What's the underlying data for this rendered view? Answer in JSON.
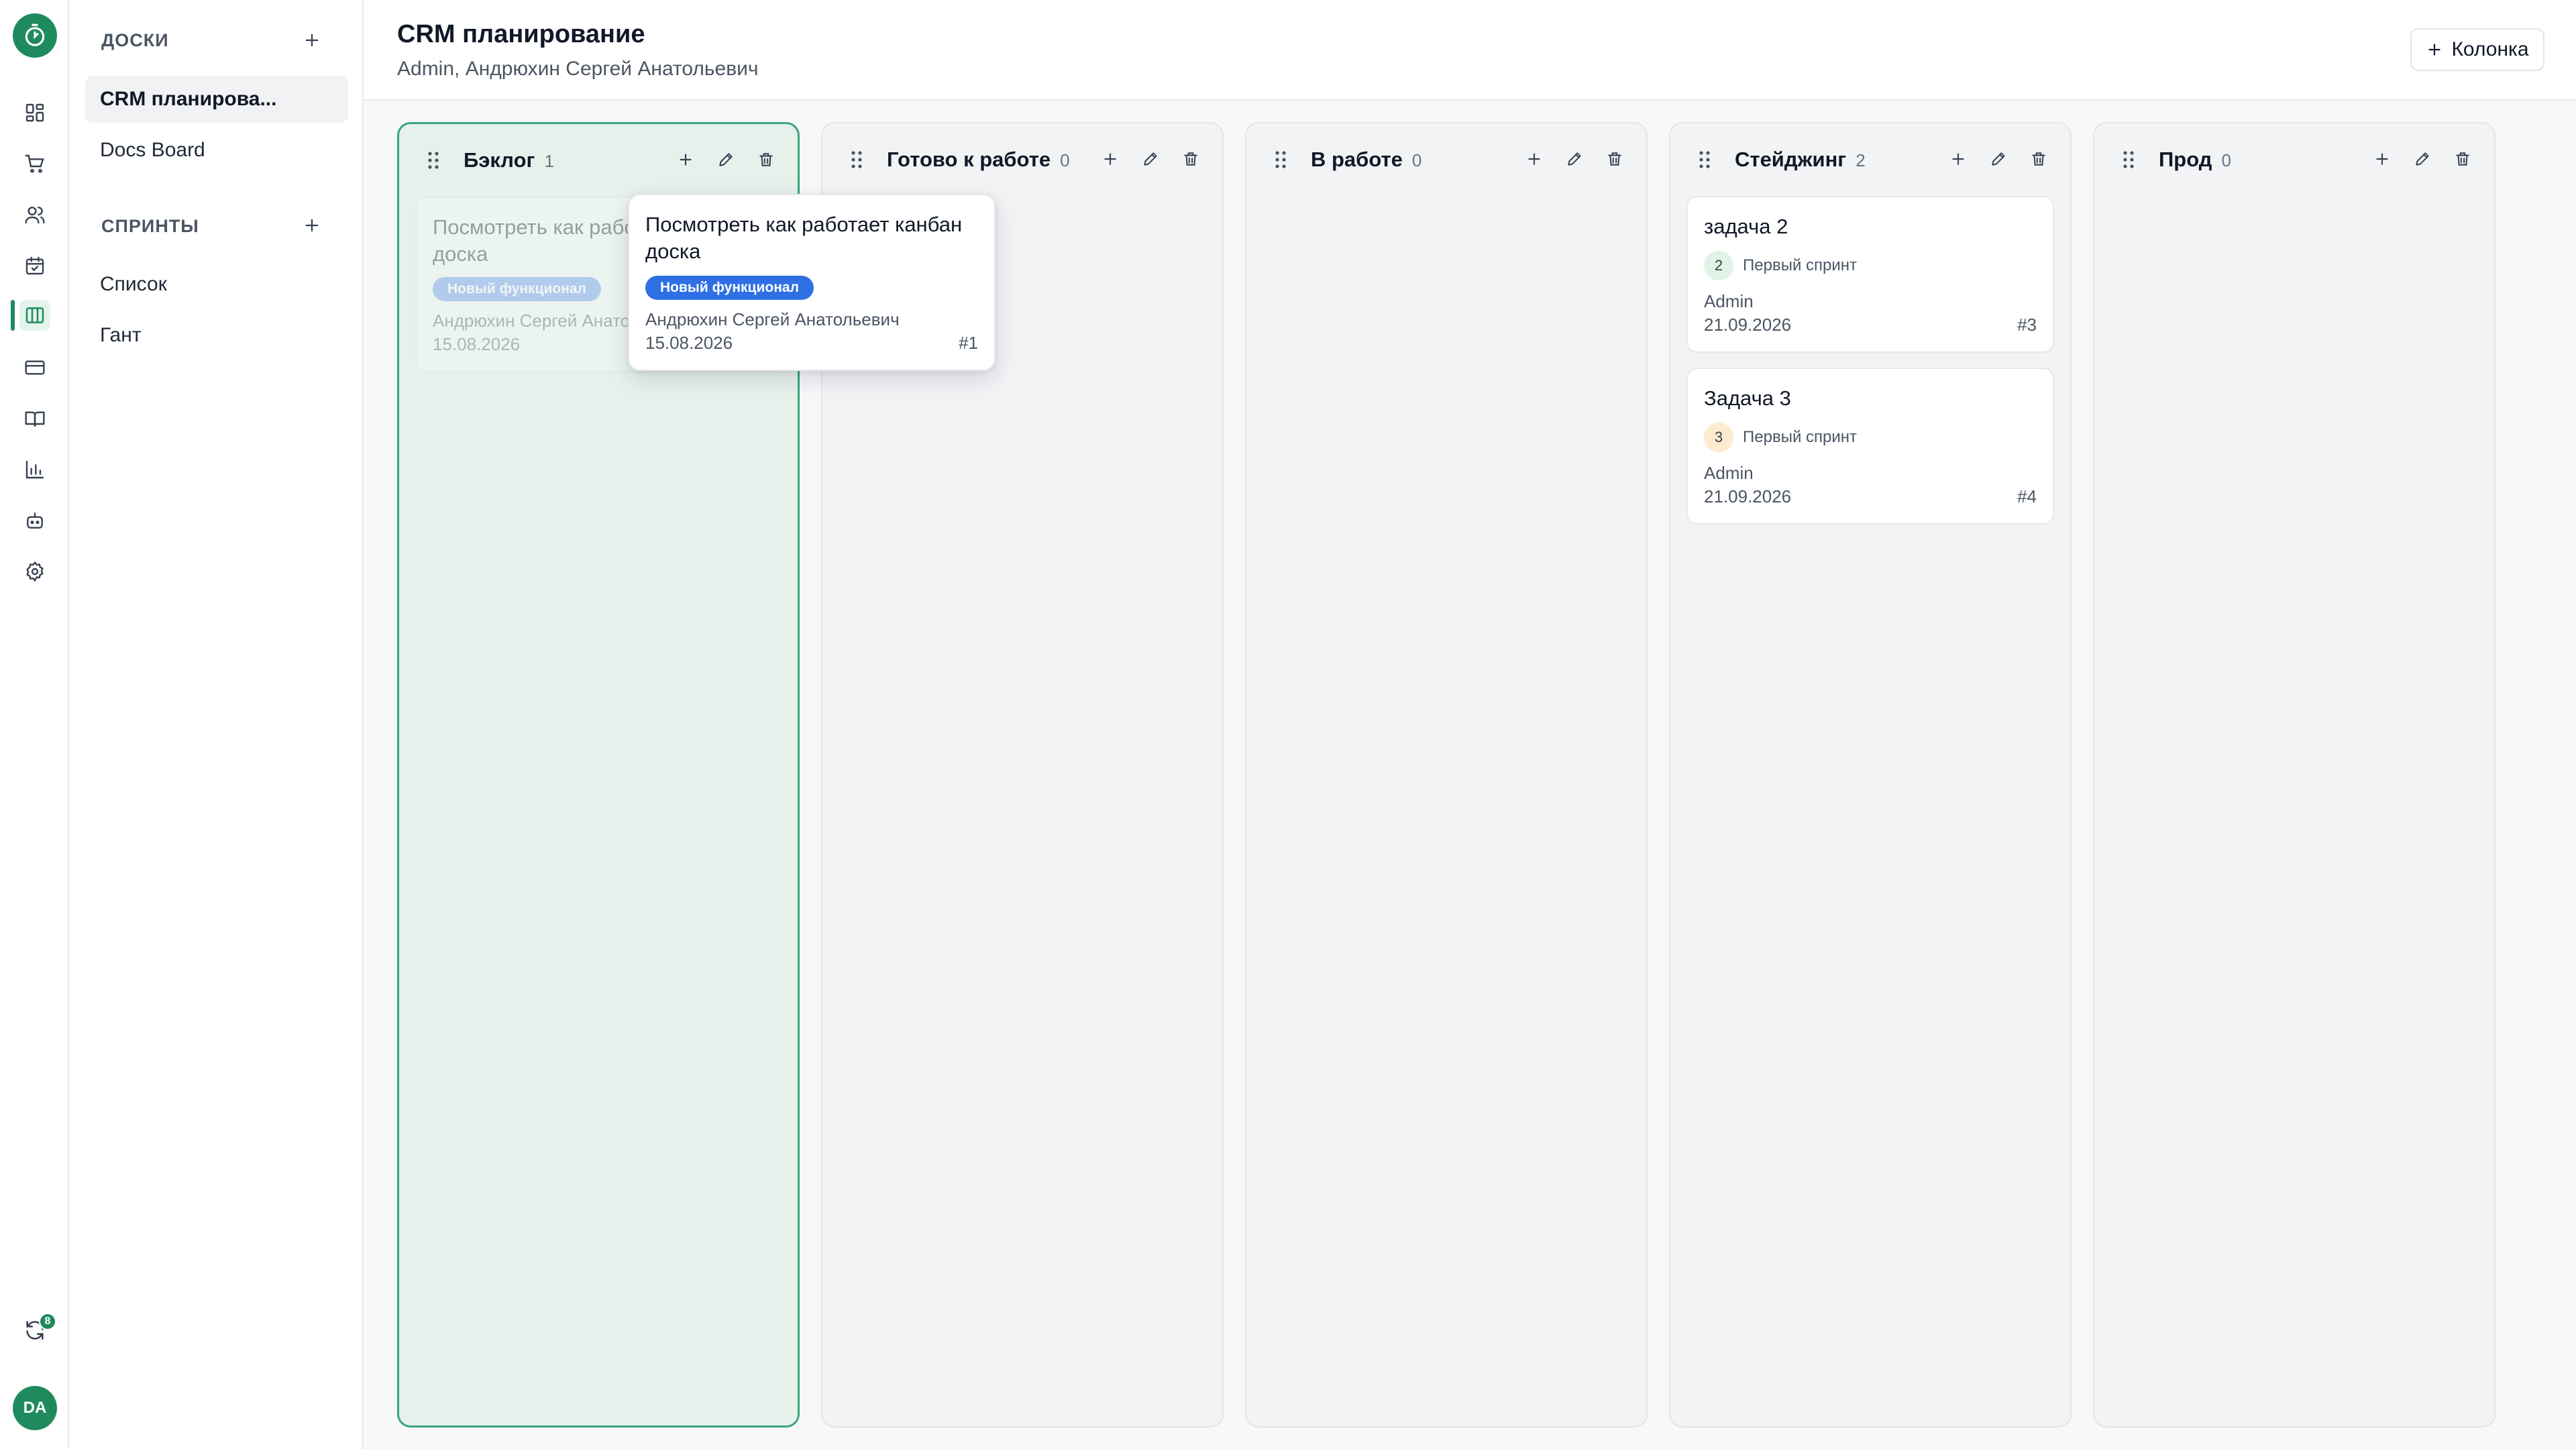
{
  "colors": {
    "brand": "#1f8a5d",
    "tag_blue": "#2f6fe4",
    "sprint_green_bg": "#dff3e6",
    "sprint_orange_bg": "#fdebcf"
  },
  "rail": {
    "icons": [
      "dashboard-icon",
      "cart-icon",
      "users-icon",
      "calendar-icon",
      "kanban-icon",
      "card-icon",
      "book-icon",
      "chart-icon",
      "bot-icon",
      "settings-icon"
    ],
    "active": "kanban-icon",
    "sync_badge": "8",
    "avatar": "DA"
  },
  "sidebar": {
    "boards_title": "ДОСКИ",
    "boards": [
      {
        "label": "CRM планирова..."
      },
      {
        "label": "Docs Board"
      }
    ],
    "sprints_title": "СПРИНТЫ",
    "sprint_items": [
      {
        "label": "Список"
      },
      {
        "label": "Гант"
      }
    ]
  },
  "header": {
    "title": "CRM планирование",
    "subtitle": "Admin, Андрюхин Сергей Анатольевич",
    "add_column_label": "Колонка"
  },
  "columns": [
    {
      "title": "Бэклог",
      "count": "1",
      "cards": [
        {
          "title": "Посмотреть как работает канбан доска",
          "tag": "Новый функционал",
          "assignee": "Андрюхин Сергей Анатольевич",
          "date": "15.08.2026"
        }
      ]
    },
    {
      "title": "Готово к работе",
      "count": "0",
      "cards": []
    },
    {
      "title": "В работе",
      "count": "0",
      "cards": []
    },
    {
      "title": "Стейджинг",
      "count": "2",
      "cards": [
        {
          "title": "задача 2",
          "sprint_num": "2",
          "sprint": "Первый спринт",
          "assignee": "Admin",
          "date": "21.09.2026",
          "id": "#3"
        },
        {
          "title": "Задача 3",
          "sprint_num": "3",
          "sprint": "Первый спринт",
          "assignee": "Admin",
          "date": "21.09.2026",
          "id": "#4"
        }
      ]
    },
    {
      "title": "Прод",
      "count": "0",
      "cards": []
    }
  ],
  "dragging_card": {
    "title": "Посмотреть как работает канбан доска",
    "tag": "Новый функционал",
    "assignee": "Андрюхин Сергей Анатольевич",
    "date": "15.08.2026",
    "id": "#1"
  }
}
